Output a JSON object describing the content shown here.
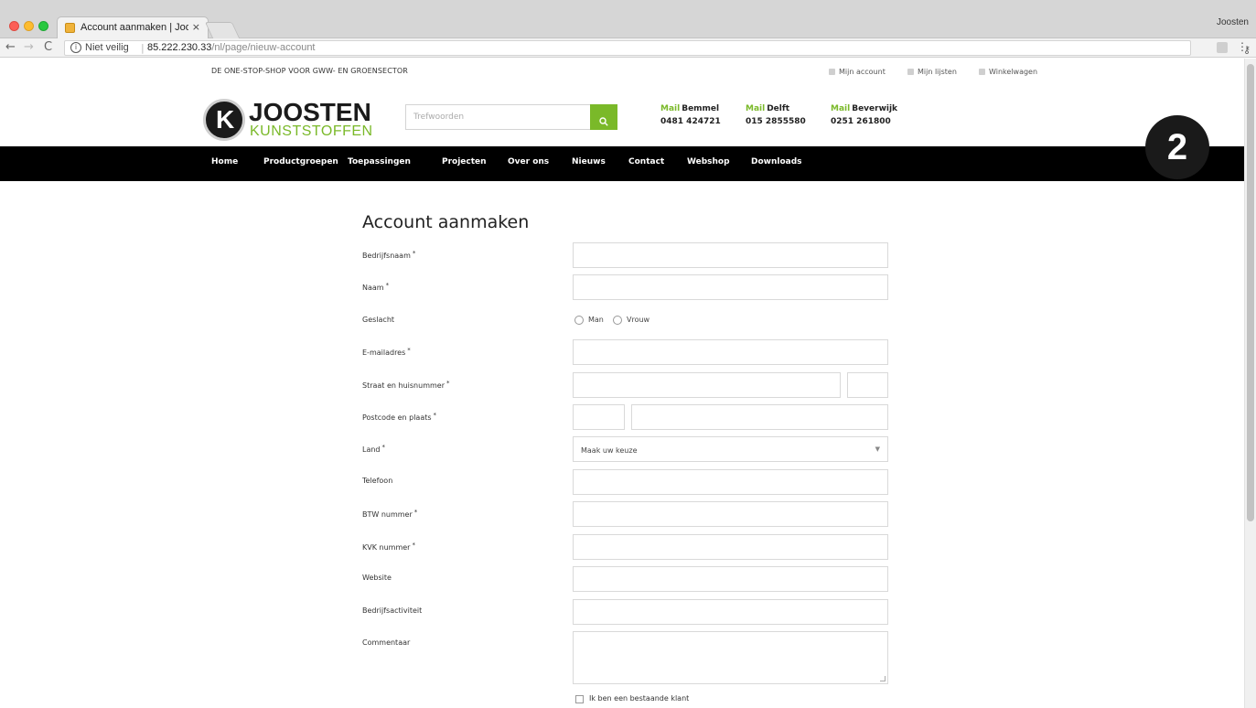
{
  "browser": {
    "tab_title": "Account aanmaken | Joosten K",
    "tab_close": "×",
    "profile": "Joosten",
    "security_label": "Niet veilig",
    "url_host": "85.222.230.33",
    "url_path": "/nl/page/nieuw-account"
  },
  "topbar": {
    "slogan": "DE ONE-STOP-SHOP VOOR GWW- EN GROENSECTOR",
    "links": {
      "account": "Mijn account",
      "lists": "Mijn lijsten",
      "cart": "Winkelwagen"
    }
  },
  "header": {
    "logo_top": "JOOSTEN",
    "logo_bottom": "KUNSTSTOFFEN",
    "logo_mark": "K",
    "search_placeholder": "Trefwoorden",
    "offices": [
      {
        "mail": "Mail",
        "name": "Bemmel",
        "phone": "0481 424721"
      },
      {
        "mail": "Mail",
        "name": "Delft",
        "phone": "015 2855580"
      },
      {
        "mail": "Mail",
        "name": "Beverwijk",
        "phone": "0251 261800"
      }
    ]
  },
  "nav": {
    "items": [
      "Home",
      "Productgroepen",
      "Toepassingen",
      "Projecten",
      "Over ons",
      "Nieuws",
      "Contact",
      "Webshop",
      "Downloads"
    ]
  },
  "form": {
    "title": "Account aanmaken",
    "required_mark": "*",
    "fields": {
      "company": "Bedrijfsnaam",
      "name": "Naam",
      "gender": "Geslacht",
      "email": "E-mailadres",
      "street": "Straat en huisnummer",
      "postcode": "Postcode en plaats",
      "country": "Land",
      "phone": "Telefoon",
      "vat": "BTW nummer",
      "coc": "KVK nummer",
      "website": "Website",
      "activity": "Bedrijfsactiviteit",
      "comment": "Commentaar"
    },
    "gender_options": {
      "male": "Man",
      "female": "Vrouw"
    },
    "country_select": "Maak uw keuze",
    "existing_customer": "Ik ben een bestaande klant"
  },
  "overlay": {
    "step": "2"
  },
  "colors": {
    "brand_green": "#7ab929",
    "nav_bg": "#000000"
  }
}
